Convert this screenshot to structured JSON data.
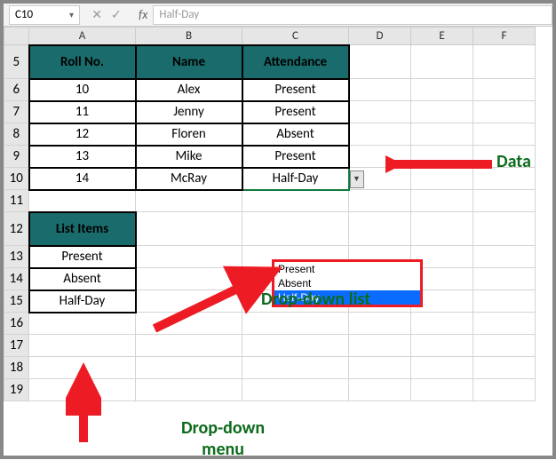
{
  "formula_bar": {
    "cell_ref": "C10",
    "fx_label": "fx",
    "formula_value": "Half-Day"
  },
  "columns": [
    "A",
    "B",
    "C",
    "D",
    "E",
    "F"
  ],
  "row_numbers": [
    5,
    6,
    7,
    8,
    9,
    10,
    11,
    12,
    13,
    14,
    15,
    16,
    17,
    18,
    19
  ],
  "headers": {
    "roll": "Roll No.",
    "name": "Name",
    "att": "Attendance",
    "list_items": "List Items"
  },
  "data_rows": [
    {
      "roll": "10",
      "name": "Alex",
      "att": "Present"
    },
    {
      "roll": "11",
      "name": "Jenny",
      "att": "Present"
    },
    {
      "roll": "12",
      "name": "Floren",
      "att": "Absent"
    },
    {
      "roll": "13",
      "name": "Mike",
      "att": "Present"
    },
    {
      "roll": "14",
      "name": "McRay",
      "att": "Half-Day"
    }
  ],
  "list_items": [
    "Present",
    "Absent",
    "Half-Day"
  ],
  "dropdown": {
    "options": [
      "Present",
      "Absent",
      "Half-Day"
    ],
    "selected": "Half-Day"
  },
  "annotations": {
    "data": "Data",
    "dropdown_list": "Drop-down list",
    "dropdown_menu": "Drop-down\nmenu"
  },
  "chart_data": {
    "type": "table",
    "title": "Attendance",
    "columns": [
      "Roll No.",
      "Name",
      "Attendance"
    ],
    "rows": [
      [
        10,
        "Alex",
        "Present"
      ],
      [
        11,
        "Jenny",
        "Present"
      ],
      [
        12,
        "Floren",
        "Absent"
      ],
      [
        13,
        "Mike",
        "Present"
      ],
      [
        14,
        "McRay",
        "Half-Day"
      ]
    ],
    "list_items": [
      "Present",
      "Absent",
      "Half-Day"
    ]
  }
}
